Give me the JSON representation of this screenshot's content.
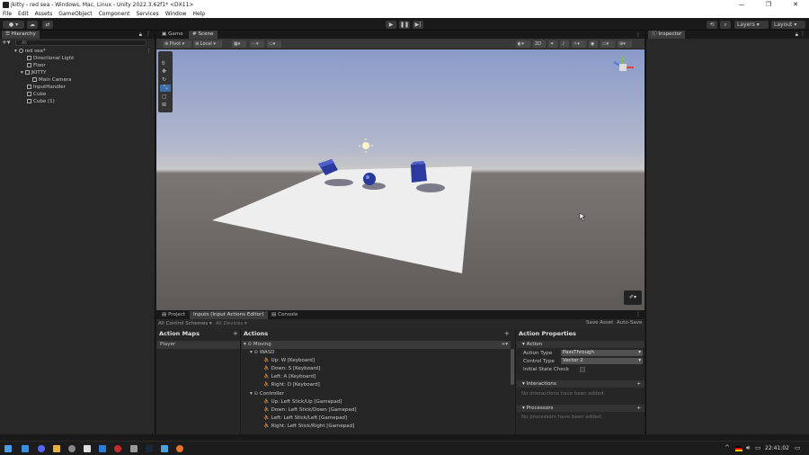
{
  "window": {
    "title": "jkitty - red sea - Windows, Mac, Linux - Unity 2022.3.62f1* <DX11>",
    "controls": [
      "—",
      "❐",
      "✕"
    ]
  },
  "menu": [
    "File",
    "Edit",
    "Assets",
    "GameObject",
    "Component",
    "Services",
    "Window",
    "Help"
  ],
  "toolbar": {
    "layers": "Layers",
    "layout": "Layout"
  },
  "hierarchy": {
    "tab": "Hierarchy",
    "search_placeholder": "All",
    "scene": "red sea*",
    "items": [
      "Directional Light",
      "Floor",
      "JKITTY",
      "Main Camera",
      "InputHandler",
      "Cube",
      "Cube (1)"
    ]
  },
  "scene_tabs": {
    "game": "Game",
    "scene": "Scene"
  },
  "scene_tools": {
    "pivot": "Pivot",
    "local": "Local",
    "mode2d": "2D"
  },
  "inspector": {
    "tab": "Inspector"
  },
  "bottom_tabs": {
    "project": "Project",
    "input": "Inputs (Input Actions Editor)",
    "console": "Console",
    "save_asset": "Save Asset",
    "auto_save": "Auto-Save"
  },
  "action_maps": {
    "header": "Action Maps",
    "control_schemes": "All Control Schemes ▾",
    "devices": "All Devices ▾",
    "items": [
      "Player"
    ]
  },
  "actions": {
    "header": "Actions",
    "root": "Moving",
    "groups": [
      {
        "name": "WASD",
        "bindings": [
          "Up: W [Keyboard]",
          "Down: S [Keyboard]",
          "Left: A [Keyboard]",
          "Right: D [Keyboard]"
        ]
      },
      {
        "name": "Controller",
        "bindings": [
          "Up: Left Stick/Up [Gamepad]",
          "Down: Left Stick/Down [Gamepad]",
          "Left: Left Stick/Left [Gamepad]",
          "Right: Left Stick/Right [Gamepad]"
        ]
      }
    ]
  },
  "action_properties": {
    "header": "Action Properties",
    "section_action": "Action",
    "action_type_label": "Action Type",
    "action_type": "PassThrough",
    "control_type_label": "Control Type",
    "control_type": "Vector 2",
    "initial_state_label": "Initial State Check",
    "interactions": "Interactions",
    "interactions_empty": "No interactions have been added.",
    "processors": "Processors",
    "processors_empty": "No processors have been added."
  },
  "taskbar": {
    "time": "22:41:02"
  }
}
